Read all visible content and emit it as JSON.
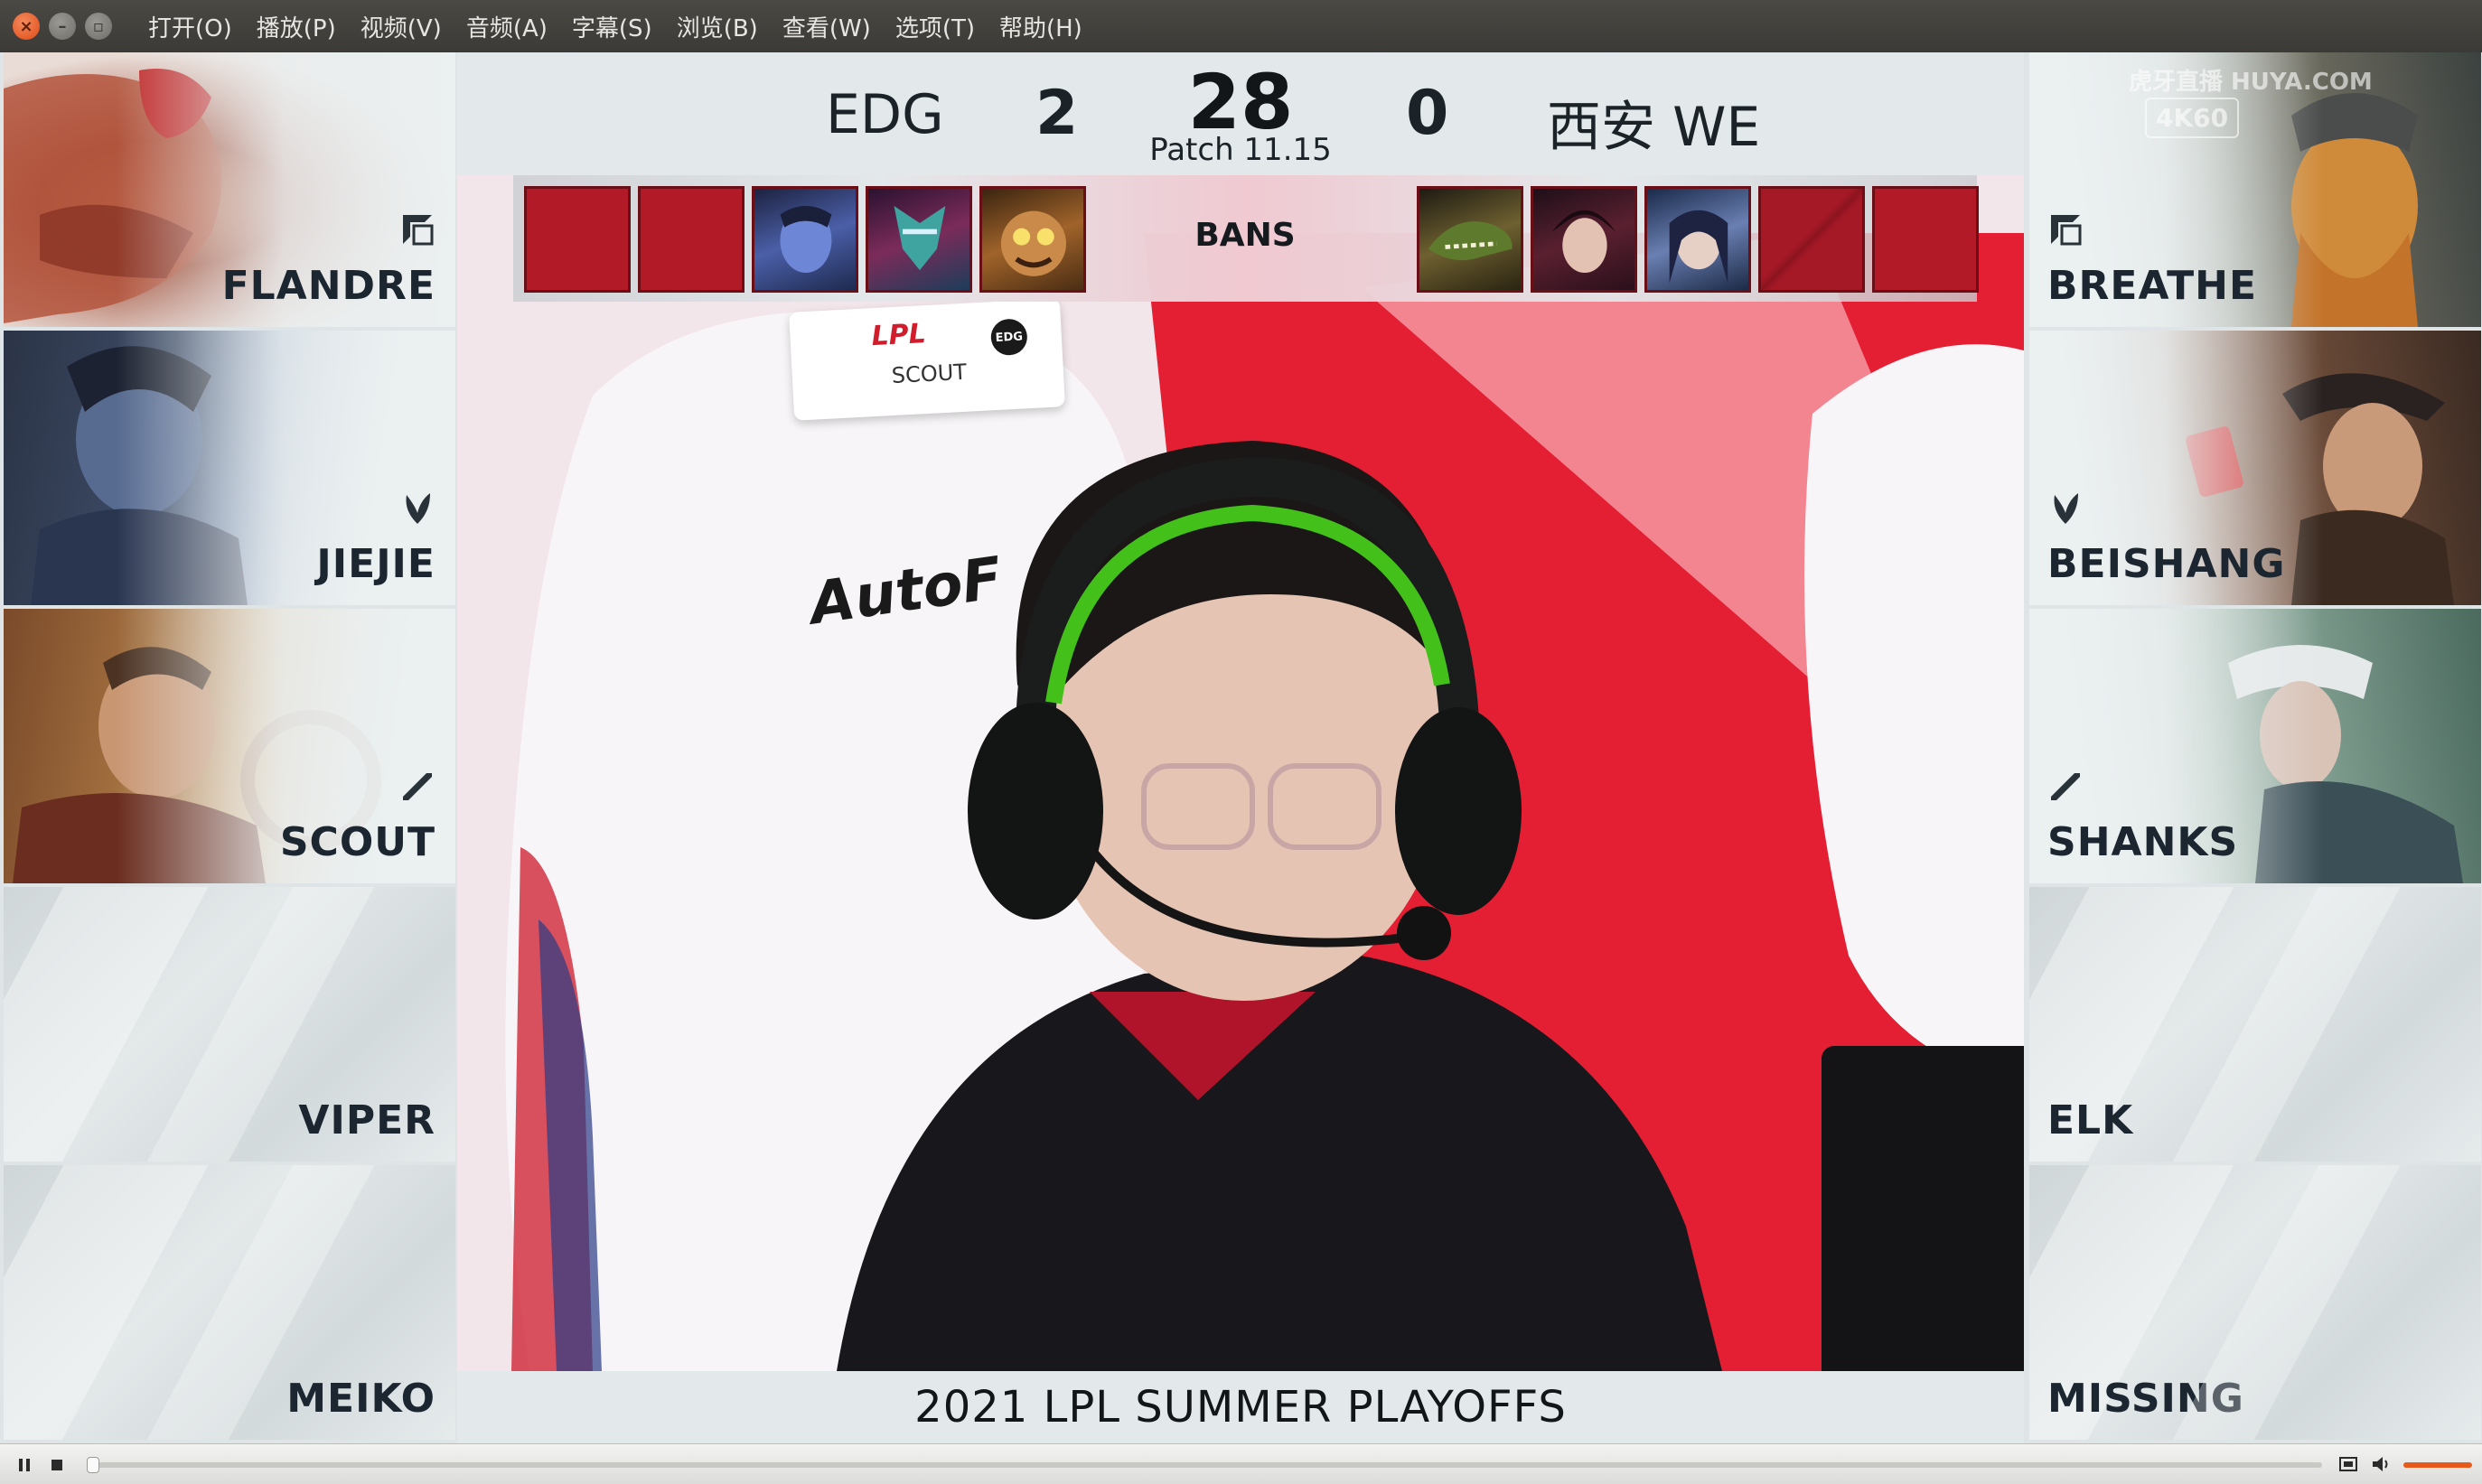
{
  "menu": [
    "打开(O)",
    "播放(P)",
    "视频(V)",
    "音频(A)",
    "字幕(S)",
    "浏览(B)",
    "查看(W)",
    "选项(T)",
    "帮助(H)"
  ],
  "scoreboard": {
    "left_team": "EDG",
    "left_score": "2",
    "timer": "28",
    "patch": "Patch 11.15",
    "right_score": "0",
    "right_team": "西安 WE",
    "bans_label": "BANS"
  },
  "players_left": [
    "FLANDRE",
    "JIEJIE",
    "SCOUT",
    "VIPER",
    "MEIKO"
  ],
  "players_right": [
    "BREATHE",
    "BEISHANG",
    "SHANKS",
    "ELK",
    "MISSING"
  ],
  "event_title": "2021 LPL SUMMER PLAYOFFS",
  "watermark": {
    "brand": "虎牙直播 HUYA.COM",
    "res": "4K60"
  },
  "stage_text": {
    "seat_label": "SCOUT",
    "lpl_logo": "LPL",
    "edg_logo": "EDG",
    "chair_brand": "AutoF"
  },
  "colors": {
    "ban_red": "#b11a26",
    "menu_bg": "#3c3b37",
    "accent_orange": "#e85a1c"
  },
  "player_controls": {
    "pause_icon": "pause-icon",
    "stop_icon": "stop-icon",
    "fullscreen_icon": "fullscreen-icon",
    "volume_icon": "volume-icon"
  }
}
